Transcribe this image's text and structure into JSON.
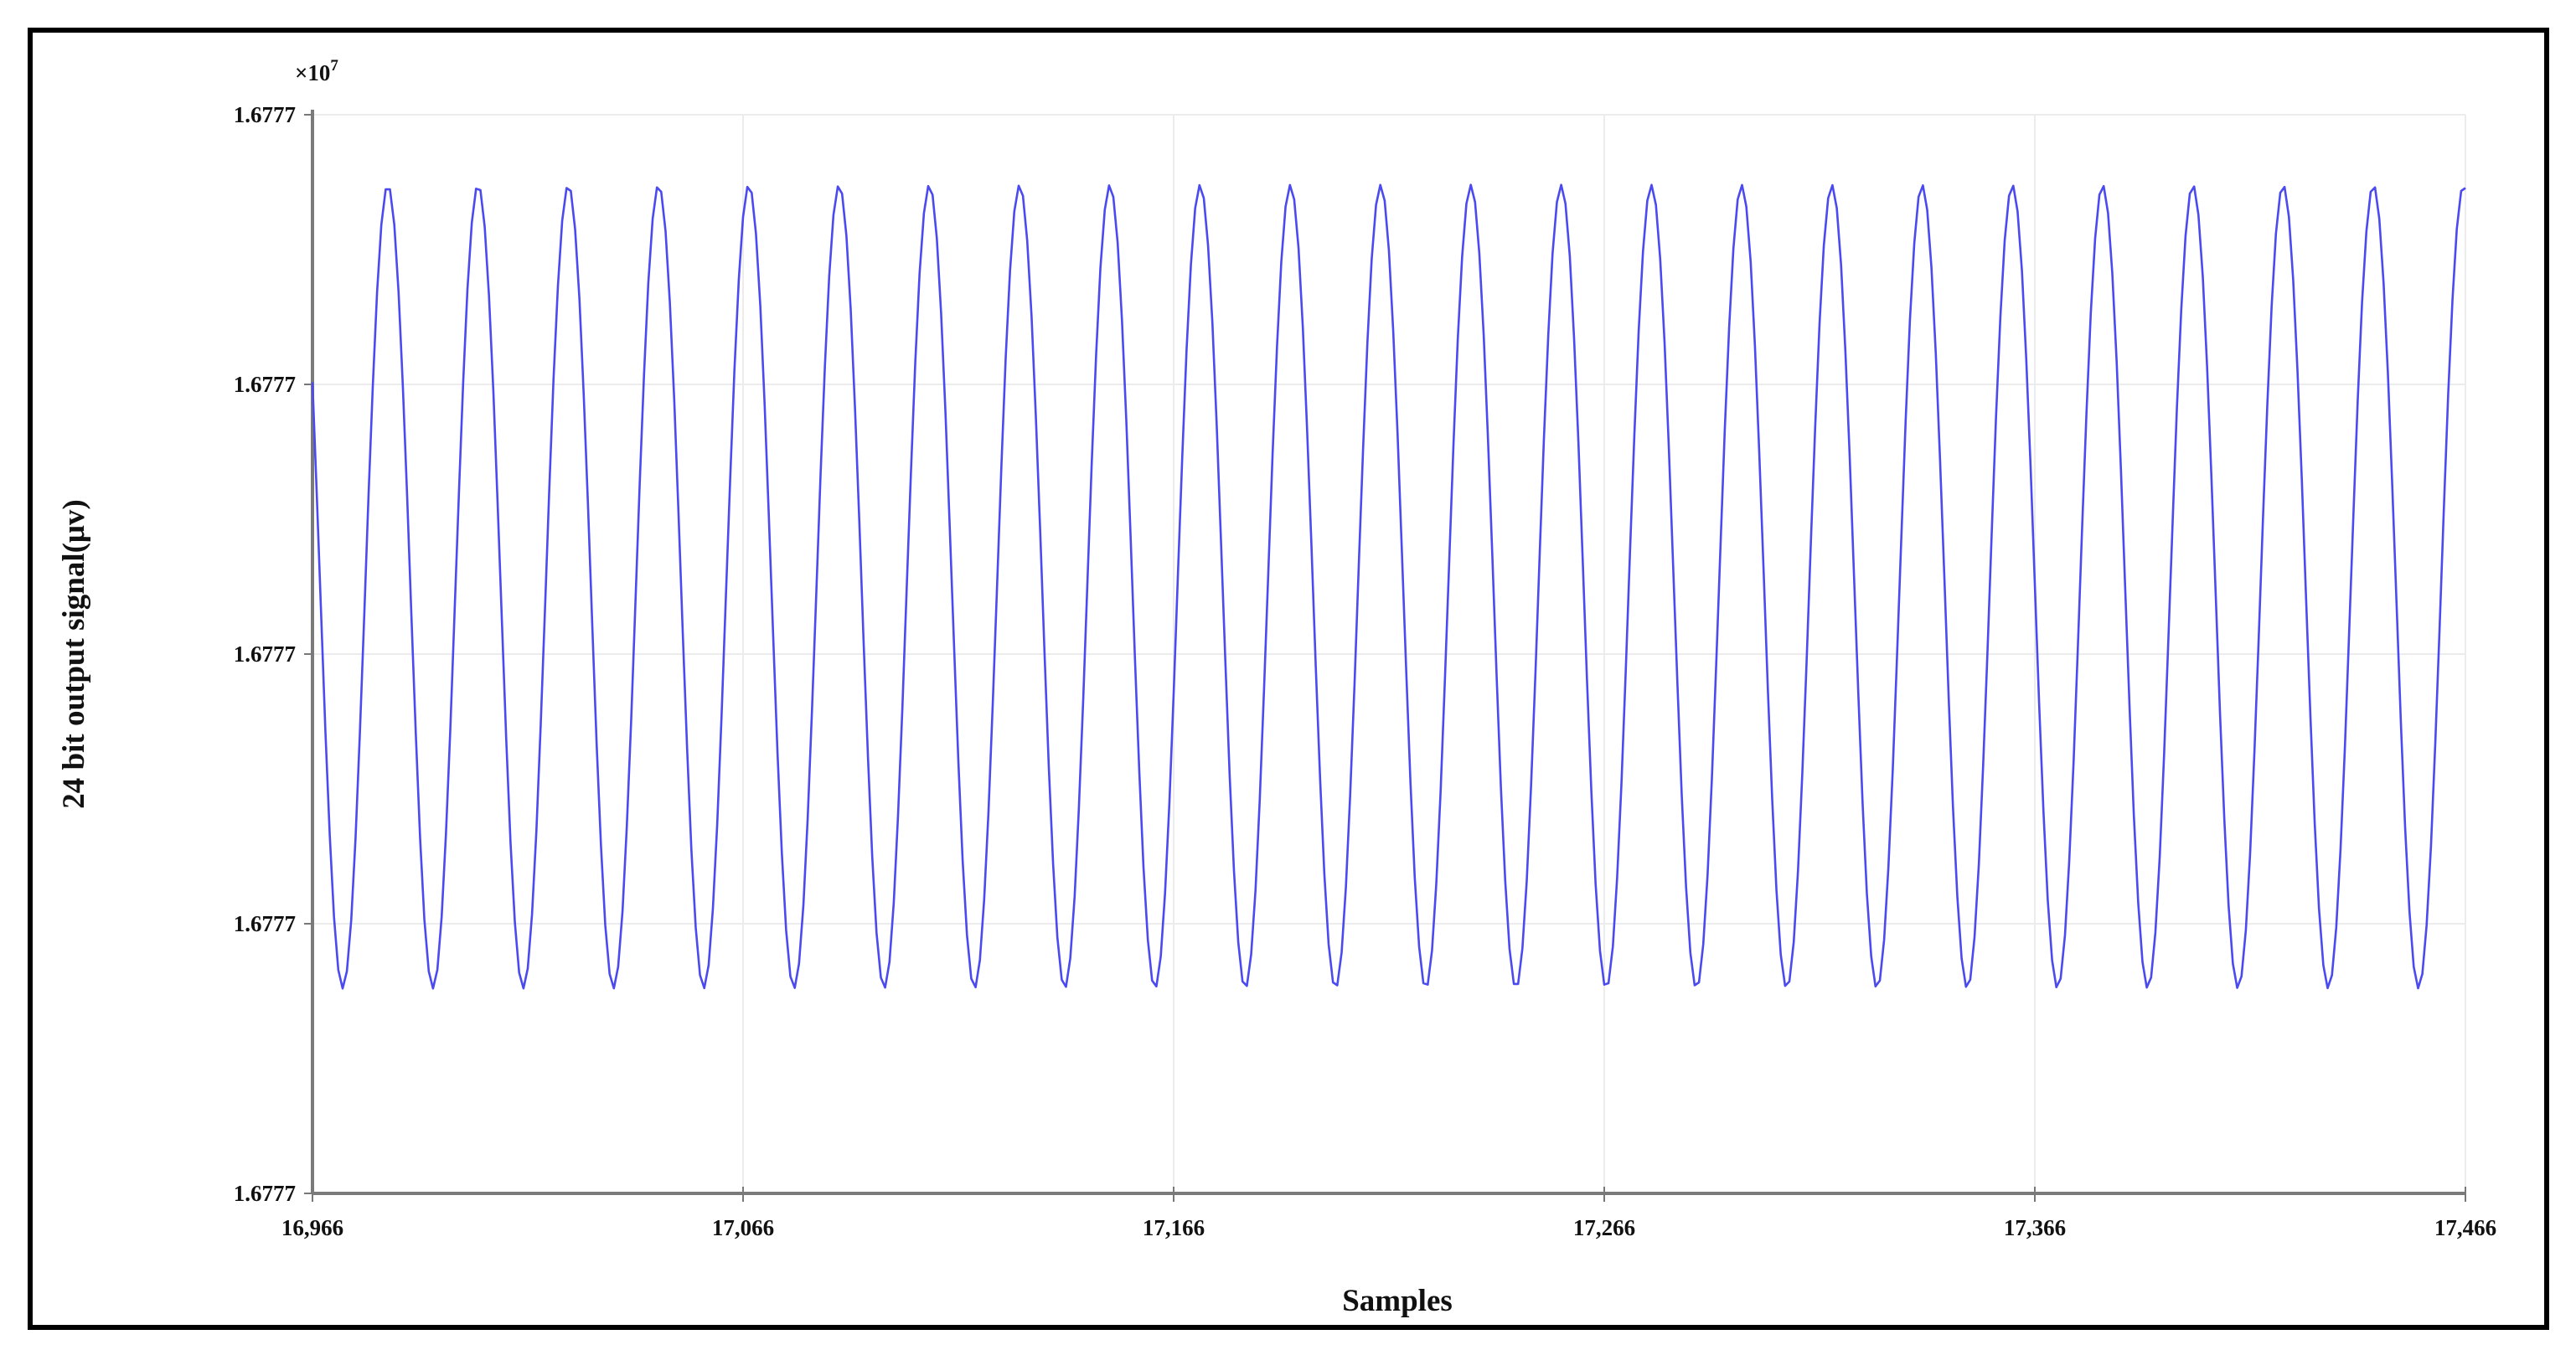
{
  "chart_data": {
    "type": "line",
    "title": "",
    "xlabel": "Samples",
    "ylabel": "24 bit output signal(μv)",
    "y_multiplier": "×10",
    "y_multiplier_exp": "7",
    "xlim": [
      16966,
      17466
    ],
    "ylim_relative": [
      0,
      4
    ],
    "x_ticks": [
      16966,
      17066,
      17166,
      17266,
      17366,
      17466
    ],
    "x_tick_labels": [
      "16,966",
      "17,066",
      "17,166",
      "17,266",
      "17,366",
      "17,466"
    ],
    "y_ticks_relative": [
      0,
      1,
      2,
      3,
      4
    ],
    "y_tick_labels": [
      "1.6777",
      "1.6777",
      "1.6777",
      "1.6777",
      "1.6777"
    ],
    "grid": true,
    "series": [
      {
        "name": "signal",
        "color": "#4a4af0",
        "model": "sinusoid",
        "center_relative": 2.25,
        "amplitude_relative": 1.49,
        "period_samples": 20.96,
        "first_peak_sample": 16983.5,
        "sample_step": 1
      }
    ]
  }
}
